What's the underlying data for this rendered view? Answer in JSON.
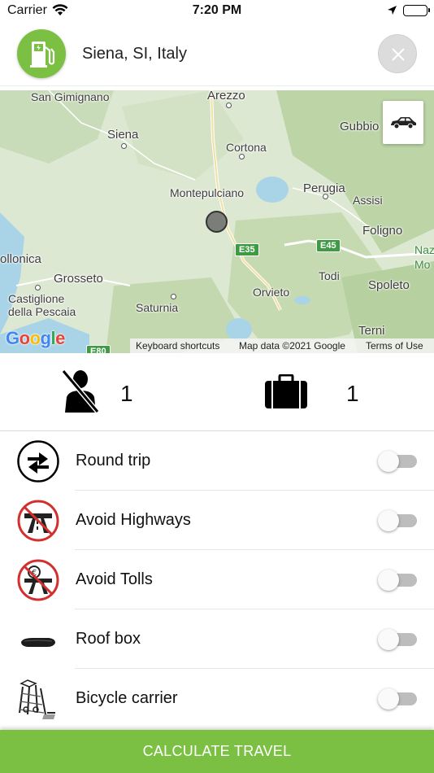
{
  "status_bar": {
    "carrier": "Carrier",
    "time": "7:20 PM"
  },
  "header": {
    "location": "Siena, SI, Italy",
    "fuel_icon": "fuel-station-icon",
    "close_icon": "close-icon"
  },
  "map": {
    "labels": {
      "san_gimignano": "San Gimignano",
      "arezzo": "Arezzo",
      "gubbio": "Gubbio",
      "siena": "Siena",
      "cortona": "Cortona",
      "montepulciano": "Montepulciano",
      "perugia": "Perugia",
      "assisi": "Assisi",
      "foligno": "Foligno",
      "follonica": "ollonica",
      "grosseto": "Grosseto",
      "castiglione": "Castiglione",
      "della_pescaia": "della Pescaia",
      "saturnia": "Saturnia",
      "orvieto": "Orvieto",
      "todi": "Todi",
      "spoleto": "Spoleto",
      "terni": "Terni",
      "naz": "Naz",
      "mo": "Mo",
      "e35": "E35",
      "e45": "E45",
      "e80": "E80"
    },
    "google_logo": "Google",
    "footer": {
      "shortcuts": "Keyboard shortcuts",
      "map_data": "Map data ©2021 Google",
      "terms": "Terms of Use"
    },
    "car_icon": "car-icon"
  },
  "counters": {
    "passengers": {
      "icon": "no-passenger-icon",
      "value": "1"
    },
    "luggage": {
      "icon": "suitcase-icon",
      "value": "1"
    }
  },
  "options": [
    {
      "label": "Round trip",
      "icon": "round-trip-icon",
      "enabled": false
    },
    {
      "label": "Avoid Highways",
      "icon": "no-highway-icon",
      "enabled": false
    },
    {
      "label": "Avoid Tolls",
      "icon": "no-toll-icon",
      "enabled": false
    },
    {
      "label": "Roof box",
      "icon": "roof-box-icon",
      "enabled": false
    },
    {
      "label": "Bicycle carrier",
      "icon": "bicycle-carrier-icon",
      "enabled": false
    }
  ],
  "action": {
    "calculate": "CALCULATE TRAVEL"
  },
  "colors": {
    "accent": "#7bc043",
    "toggle_off": "#bdbdbd"
  }
}
